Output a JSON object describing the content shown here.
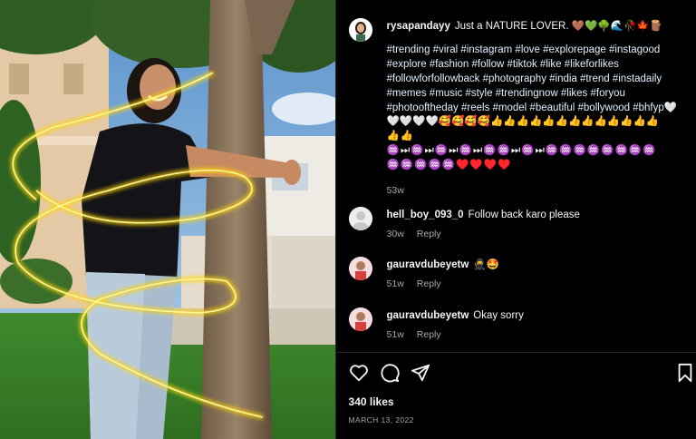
{
  "post": {
    "username": "rysapandayy",
    "caption": "Just a NATURE LOVER. 🤎💚🌳🌊🥀🍁🪵",
    "hashtags": "#trending #viral #instagram #love #explorepage #instagood #explore #fashion #follow #tiktok #like #likeforlikes #followforfollowback #photography #india #trend #instadaily #memes #music #style #trendingnow #likes #foryou #photooftheday #reels #model #beautiful #bollywood #bhfyp🤍🤍🤍🤍🤍🥰🥰🥰🥰👍👍👍👍👍👍👍👍👍👍👍👍👍",
    "emoji_rows": [
      "👍👍",
      "♒⏭♒⏭♒⏭♒⏭♒♒⏭♒⏭♒♒♒♒♒♒♒♒",
      "♒♒♒♒♒♥️♥️♥️♥️"
    ],
    "time": "53w",
    "likes": "340 likes",
    "date": "MARCH 13, 2022"
  },
  "comments": [
    {
      "username": "hell_boy_093_0",
      "text": "Follow back karo please",
      "time": "30w",
      "reply": "Reply"
    },
    {
      "username": "gauravdubeyetw",
      "text": "🥷🤩",
      "time": "51w",
      "reply": "Reply"
    },
    {
      "username": "gauravdubeyetw",
      "text": "Okay sorry",
      "time": "51w",
      "reply": "Reply"
    }
  ],
  "colors": {
    "background": "#000000",
    "text": "#f5f5f5",
    "muted": "#a8a8a8",
    "glow": "#ffd400"
  },
  "icons": [
    "heart-icon",
    "comment-icon",
    "share-icon",
    "bookmark-icon"
  ]
}
